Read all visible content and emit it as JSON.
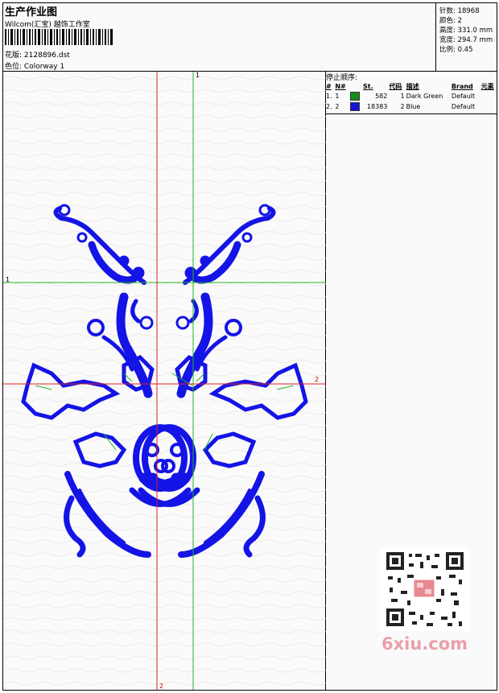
{
  "header": {
    "title": "生产作业图",
    "company": "Wilcom(汇宝) 越饰工作室",
    "pattern_label": "花版:",
    "pattern_value": "2128896.dst",
    "color_label": "色位:",
    "color_value": "Colorway 1"
  },
  "stats": {
    "stitches": "针数: 18968",
    "colors": "颜色: 2",
    "height": "高度: 331.0 mm",
    "width": "宽度: 294.7 mm",
    "scale": "比例: 0.45"
  },
  "stop_sequence": {
    "title": "停止顺序:",
    "columns": [
      "#",
      "N#",
      "St.",
      "代码",
      "描述",
      "Brand",
      "元素"
    ],
    "rows": [
      {
        "idx": "1.",
        "n": "1",
        "color": "#1a8c1a",
        "st": "582",
        "code": "1",
        "desc": "Dark Green",
        "brand": "Default"
      },
      {
        "idx": "2.",
        "n": "2",
        "color": "#1414d8",
        "st": "18383",
        "code": "2",
        "desc": "Blue",
        "brand": "Default"
      }
    ]
  },
  "guides": {
    "green_v": "1",
    "green_h": "1",
    "red_h": "2",
    "red_v": "2"
  },
  "qr_label": "QR code",
  "watermark": "6xiu.com",
  "colors": {
    "blue": "#1414e6",
    "green": "#22b422",
    "red": "#e02020"
  }
}
